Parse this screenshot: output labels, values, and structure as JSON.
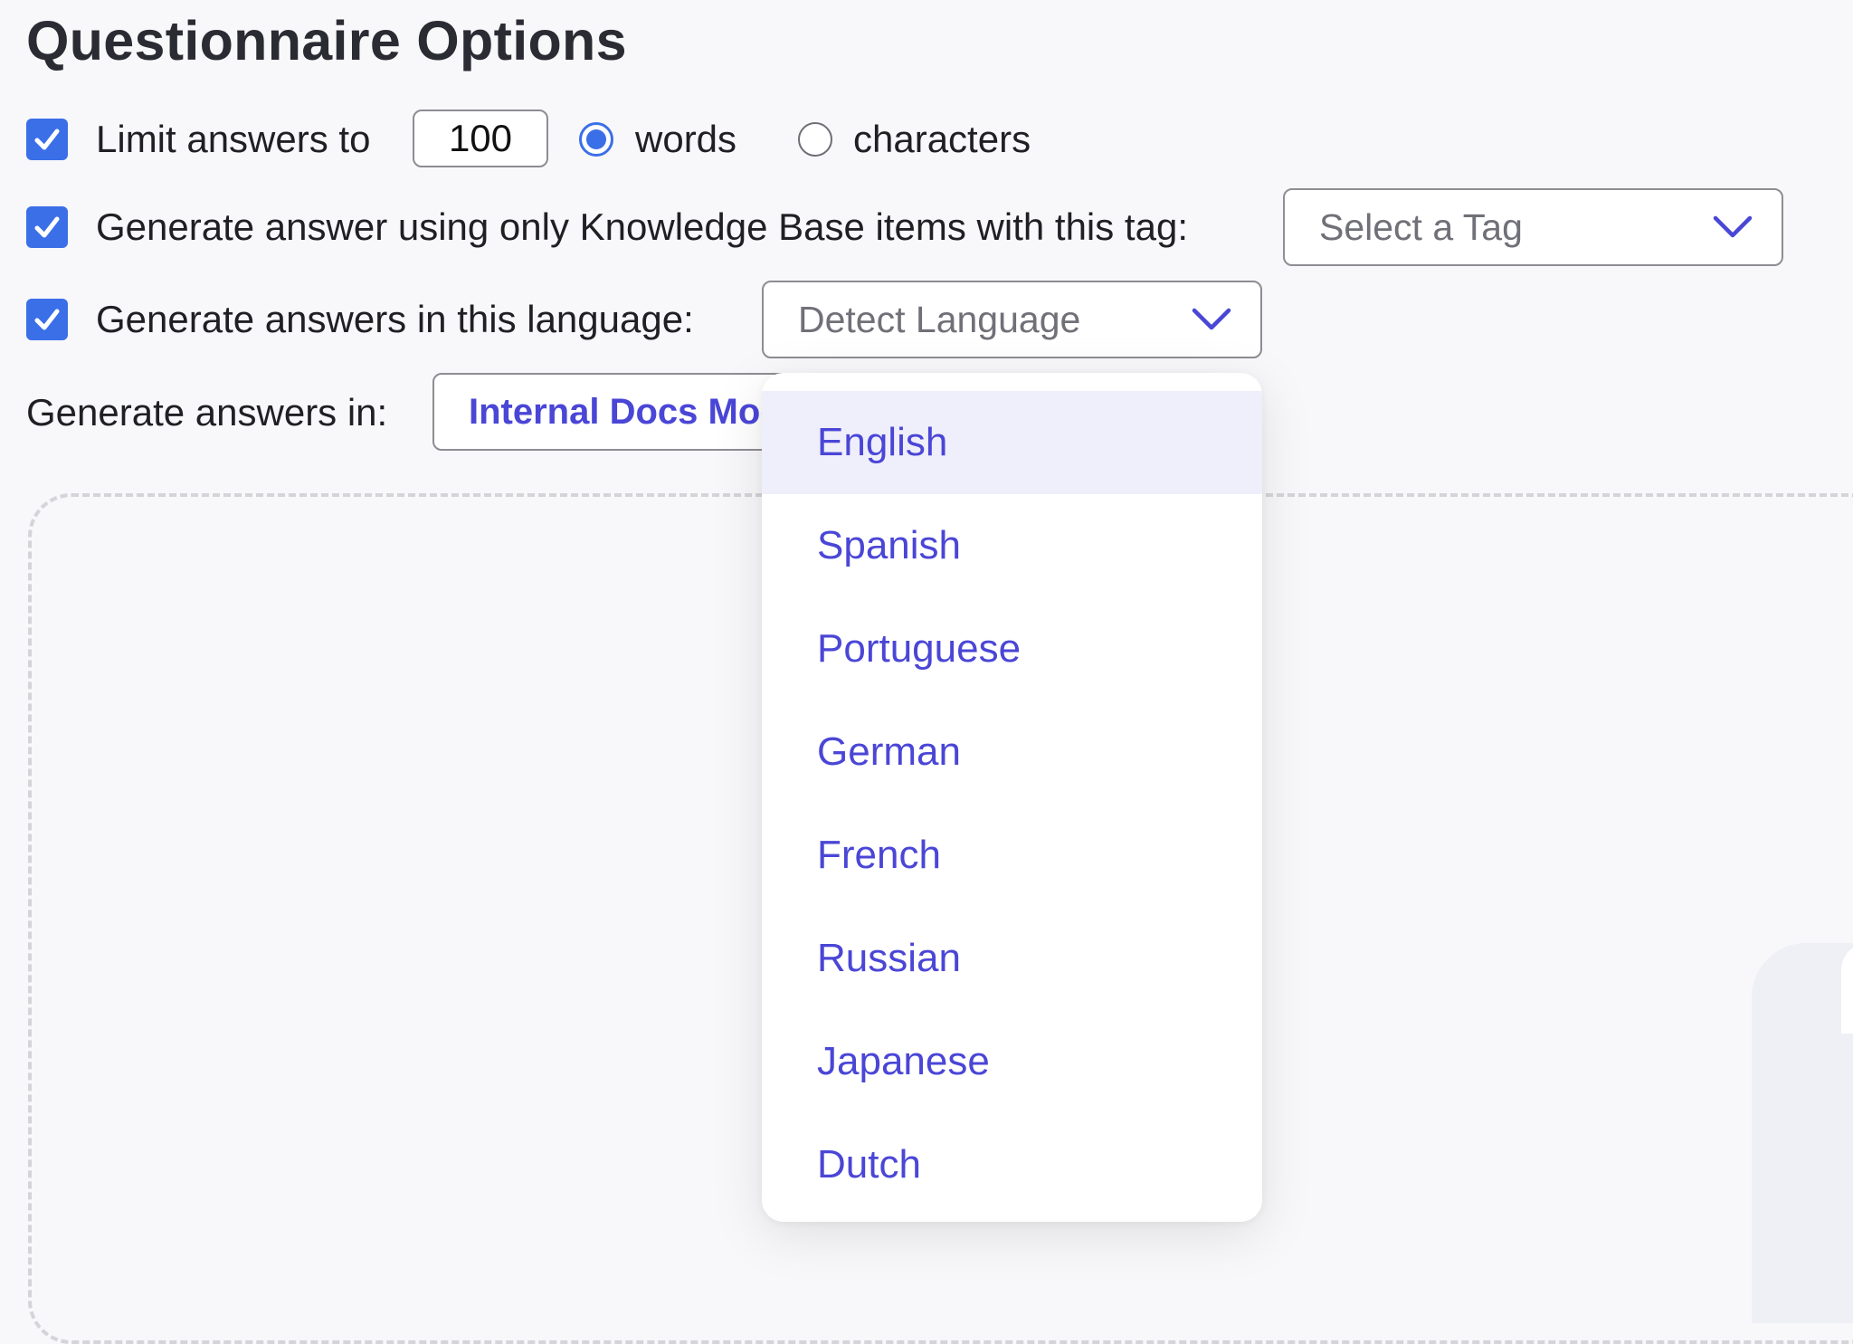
{
  "page": {
    "title": "Questionnaire Options"
  },
  "limit": {
    "label": "Limit answers to",
    "value": "100",
    "checked": true,
    "unit_options": [
      {
        "label": "words",
        "selected": true
      },
      {
        "label": "characters",
        "selected": false
      }
    ]
  },
  "tag_option": {
    "label": "Generate answer using only Knowledge Base items with this tag:",
    "checked": true,
    "select_placeholder": "Select a Tag"
  },
  "language_option": {
    "label": "Generate answers in this language:",
    "checked": true,
    "select_placeholder": "Detect Language",
    "options": [
      "English",
      "Spanish",
      "Portuguese",
      "German",
      "French",
      "Russian",
      "Japanese",
      "Dutch"
    ],
    "highlighted": "English"
  },
  "mode_option": {
    "label": "Generate answers in:",
    "selected": "Internal Docs Mode"
  },
  "colors": {
    "accent_blue": "#3b6fe8",
    "option_text": "#4a46d6",
    "highlight_bg": "#efeefb"
  }
}
